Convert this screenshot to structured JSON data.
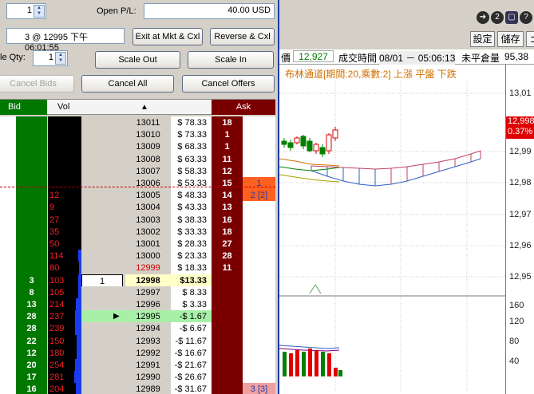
{
  "order": {
    "qty": "1",
    "open_pl_label": "Open P/L:",
    "open_pl_value": "40.00 USD",
    "position_text": "3 @ 12995 下午 06:01:55",
    "scale_qty_label": "le Qty:",
    "scale_qty": "1"
  },
  "buttons": {
    "exit_mkt": "Exit at Mkt & Cxl",
    "reverse": "Reverse & Cxl",
    "scale_out": "Scale Out",
    "scale_in": "Scale In",
    "cancel_bids": "Cancel Bids",
    "cancel_all": "Cancel All",
    "cancel_offers": "Cancel Offers"
  },
  "ladder_header": {
    "bid": "Bid",
    "vol": "Vol",
    "sort_arrow": "▲",
    "ask": "Ask"
  },
  "ladder": [
    {
      "bid": "",
      "vol": "",
      "vbar": 0,
      "my": "",
      "price": "13011",
      "pnl": "$ 78.33",
      "ask": "18",
      "mine": ""
    },
    {
      "bid": "",
      "vol": "",
      "vbar": 0,
      "my": "",
      "price": "13010",
      "pnl": "$ 73.33",
      "ask": "1",
      "mine": ""
    },
    {
      "bid": "",
      "vol": "",
      "vbar": 0,
      "my": "",
      "price": "13009",
      "pnl": "$ 68.33",
      "ask": "1",
      "mine": ""
    },
    {
      "bid": "",
      "vol": "",
      "vbar": 0,
      "my": "",
      "price": "13008",
      "pnl": "$ 63.33",
      "ask": "11",
      "mine": ""
    },
    {
      "bid": "",
      "vol": "",
      "vbar": 0,
      "my": "",
      "price": "13007",
      "pnl": "$ 58.33",
      "ask": "12",
      "mine": ""
    },
    {
      "bid": "",
      "vol": "",
      "vbar": 0,
      "my": "",
      "price": "13006",
      "pnl": "$ 53.33",
      "ask": "15",
      "mine": "1"
    },
    {
      "bid": "",
      "vol": "12",
      "vbar": 0,
      "my": "",
      "price": "13005",
      "pnl": "$ 48.33",
      "ask": "14",
      "mine": "2 [2]"
    },
    {
      "bid": "",
      "vol": "9",
      "vbar": 0,
      "my": "",
      "price": "13004",
      "pnl": "$ 43.33",
      "ask": "13",
      "mine": ""
    },
    {
      "bid": "",
      "vol": "27",
      "vbar": 0,
      "my": "",
      "price": "13003",
      "pnl": "$ 38.33",
      "ask": "16",
      "mine": ""
    },
    {
      "bid": "",
      "vol": "35",
      "vbar": 0,
      "my": "",
      "price": "13002",
      "pnl": "$ 33.33",
      "ask": "18",
      "mine": ""
    },
    {
      "bid": "",
      "vol": "50",
      "vbar": 0,
      "my": "",
      "price": "13001",
      "pnl": "$ 28.33",
      "ask": "27",
      "mine": ""
    },
    {
      "bid": "",
      "vol": "114",
      "vbar": 0.2,
      "my": "",
      "price": "13000",
      "pnl": "$ 23.33",
      "ask": "28",
      "mine": ""
    },
    {
      "bid": "",
      "vol": "80",
      "vbar": 0.15,
      "my": "",
      "price": "12999",
      "pnl": "$ 18.33",
      "ask": "11",
      "mine": ""
    },
    {
      "bid": "3",
      "vol": "103",
      "vbar": 0.18,
      "my": "1",
      "price": "12998",
      "pnl": "$13.33",
      "ask": "",
      "mine": ""
    },
    {
      "bid": "8",
      "vol": "105",
      "vbar": 0.2,
      "my": "",
      "price": "12997",
      "pnl": "$ 8.33",
      "ask": "",
      "mine": ""
    },
    {
      "bid": "13",
      "vol": "214",
      "vbar": 0.35,
      "my": "",
      "price": "12996",
      "pnl": "$ 3.33",
      "ask": "",
      "mine": ""
    },
    {
      "bid": "28",
      "vol": "237",
      "vbar": 0.4,
      "my": "",
      "price": "12995",
      "pnl": "-$ 1.67",
      "ask": "",
      "mine": ""
    },
    {
      "bid": "28",
      "vol": "239",
      "vbar": 0.4,
      "my": "",
      "price": "12994",
      "pnl": "-$ 6.67",
      "ask": "",
      "mine": ""
    },
    {
      "bid": "22",
      "vol": "150",
      "vbar": 0.28,
      "my": "",
      "price": "12993",
      "pnl": "-$ 11.67",
      "ask": "",
      "mine": ""
    },
    {
      "bid": "12",
      "vol": "180",
      "vbar": 0.3,
      "my": "",
      "price": "12992",
      "pnl": "-$ 16.67",
      "ask": "",
      "mine": ""
    },
    {
      "bid": "20",
      "vol": "254",
      "vbar": 0.42,
      "my": "",
      "price": "12991",
      "pnl": "-$ 21.67",
      "ask": "",
      "mine": ""
    },
    {
      "bid": "17",
      "vol": "281",
      "vbar": 0.46,
      "my": "",
      "price": "12990",
      "pnl": "-$ 26.67",
      "ask": "",
      "mine": ""
    },
    {
      "bid": "16",
      "vol": "204",
      "vbar": 0.35,
      "my": "",
      "price": "12989",
      "pnl": "-$ 31.67",
      "ask": "",
      "mine": "3 [3]"
    }
  ],
  "chart": {
    "buttons": {
      "settings": "設定",
      "store": "儲存"
    },
    "info_last": "12,927",
    "info_time_label": "成交時間",
    "info_time": "08/01 － 05:06:13",
    "info_oi_label": "未平倉量",
    "info_oi": "95,38",
    "info_prefix": "價",
    "indicator": "布林通道[期間:20,乘數:2] 上漲  平盤  下跌",
    "price_ticks": [
      "13,01",
      "12,99",
      "12,98",
      "12,97",
      "12,96",
      "12,95"
    ],
    "last_price": "12,998",
    "last_pct": "0.37%",
    "vol_ticks": [
      "160",
      "120",
      "80",
      "40"
    ],
    "colors": {
      "up": "#e00000",
      "down": "#008000",
      "accent": "#1c3caa"
    }
  }
}
